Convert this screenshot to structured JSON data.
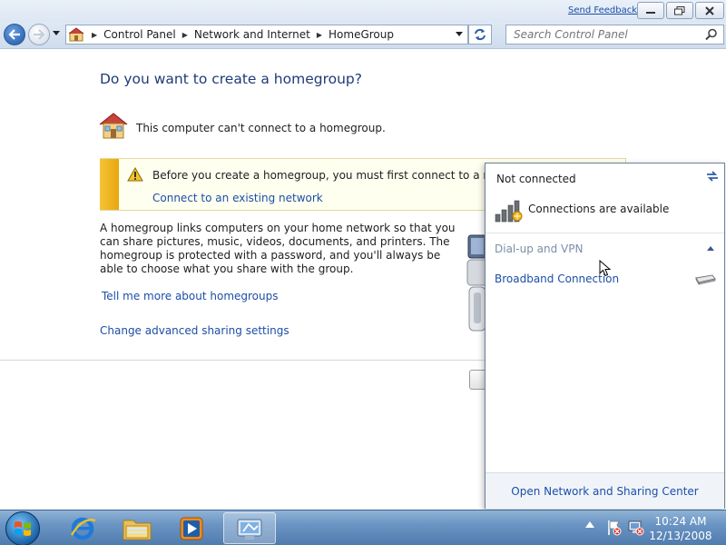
{
  "window": {
    "send_feedback": "Send Feedback"
  },
  "address": {
    "crumbs": [
      "Control Panel",
      "Network and Internet",
      "HomeGroup"
    ]
  },
  "search": {
    "placeholder": "Search Control Panel"
  },
  "main": {
    "title": "Do you want to create a homegroup?",
    "cannot_connect": "This computer can't connect to a homegroup.",
    "warning_text": "Before you create a homegroup, you must first connect to a network.",
    "connect_link": "Connect to an existing network",
    "description": "A homegroup links computers on your home network so that you can share pictures, music, videos, documents, and printers. The homegroup is protected with a password, and you'll always be able to choose what you share with the group.",
    "tell_more_link": "Tell me more about homegroups",
    "advanced_link": "Change advanced sharing settings"
  },
  "flyout": {
    "status": "Not connected",
    "connections_available": "Connections are available",
    "group_header": "Dial-up and VPN",
    "items": [
      {
        "label": "Broadband Connection",
        "icon": "modem-icon"
      }
    ],
    "footer_link": "Open Network and Sharing Center"
  },
  "taskbar": {
    "pinned": [
      {
        "name": "Internet Explorer",
        "icon": "ie-icon"
      },
      {
        "name": "Windows Explorer",
        "icon": "folder-icon"
      },
      {
        "name": "Windows Media Player",
        "icon": "media-player-icon"
      },
      {
        "name": "Control Panel",
        "icon": "control-panel-icon"
      }
    ],
    "clock_time": "10:24 AM",
    "clock_date": "12/13/2008"
  },
  "colors": {
    "link": "#1c4ea8",
    "title": "#1e3b78",
    "warning_stripe": "#f5c436",
    "taskbar": "#4f7bae"
  }
}
